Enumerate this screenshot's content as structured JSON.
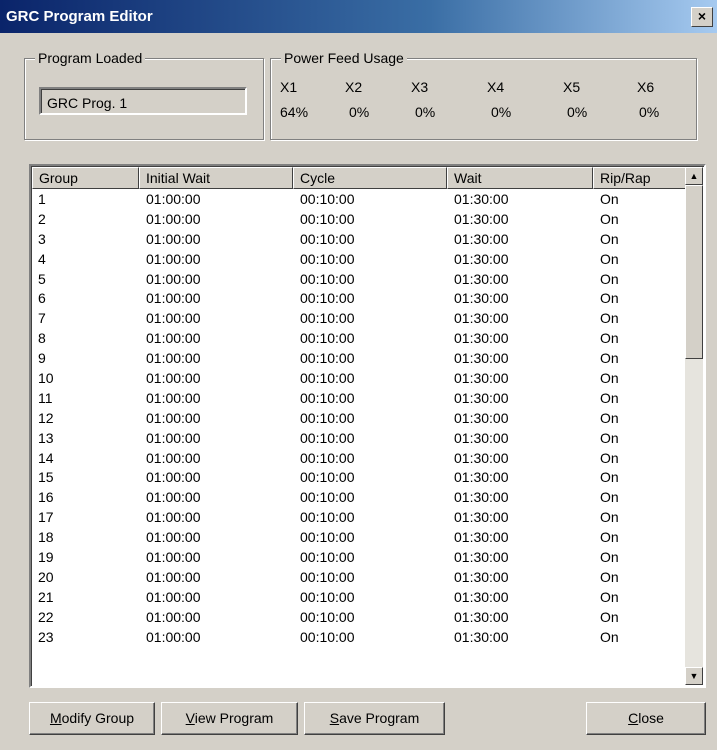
{
  "window": {
    "title": "GRC Program Editor",
    "close_glyph": "×"
  },
  "program_loaded": {
    "label": "Program Loaded",
    "value": "GRC Prog. 1"
  },
  "power_feed": {
    "label": "Power Feed Usage",
    "feeds": [
      {
        "name": "X1",
        "value": "64%"
      },
      {
        "name": "X2",
        "value": "0%"
      },
      {
        "name": "X3",
        "value": "0%"
      },
      {
        "name": "X4",
        "value": "0%"
      },
      {
        "name": "X5",
        "value": "0%"
      },
      {
        "name": "X6",
        "value": "0%"
      }
    ]
  },
  "table": {
    "columns": [
      "Group",
      "Initial Wait",
      "Cycle",
      "Wait",
      "Rip/Rap"
    ],
    "rows": [
      [
        "1",
        "01:00:00",
        "00:10:00",
        "01:30:00",
        "On"
      ],
      [
        "2",
        "01:00:00",
        "00:10:00",
        "01:30:00",
        "On"
      ],
      [
        "3",
        "01:00:00",
        "00:10:00",
        "01:30:00",
        "On"
      ],
      [
        "4",
        "01:00:00",
        "00:10:00",
        "01:30:00",
        "On"
      ],
      [
        "5",
        "01:00:00",
        "00:10:00",
        "01:30:00",
        "On"
      ],
      [
        "6",
        "01:00:00",
        "00:10:00",
        "01:30:00",
        "On"
      ],
      [
        "7",
        "01:00:00",
        "00:10:00",
        "01:30:00",
        "On"
      ],
      [
        "8",
        "01:00:00",
        "00:10:00",
        "01:30:00",
        "On"
      ],
      [
        "9",
        "01:00:00",
        "00:10:00",
        "01:30:00",
        "On"
      ],
      [
        "10",
        "01:00:00",
        "00:10:00",
        "01:30:00",
        "On"
      ],
      [
        "11",
        "01:00:00",
        "00:10:00",
        "01:30:00",
        "On"
      ],
      [
        "12",
        "01:00:00",
        "00:10:00",
        "01:30:00",
        "On"
      ],
      [
        "13",
        "01:00:00",
        "00:10:00",
        "01:30:00",
        "On"
      ],
      [
        "14",
        "01:00:00",
        "00:10:00",
        "01:30:00",
        "On"
      ],
      [
        "15",
        "01:00:00",
        "00:10:00",
        "01:30:00",
        "On"
      ],
      [
        "16",
        "01:00:00",
        "00:10:00",
        "01:30:00",
        "On"
      ],
      [
        "17",
        "01:00:00",
        "00:10:00",
        "01:30:00",
        "On"
      ],
      [
        "18",
        "01:00:00",
        "00:10:00",
        "01:30:00",
        "On"
      ],
      [
        "19",
        "01:00:00",
        "00:10:00",
        "01:30:00",
        "On"
      ],
      [
        "20",
        "01:00:00",
        "00:10:00",
        "01:30:00",
        "On"
      ],
      [
        "21",
        "01:00:00",
        "00:10:00",
        "01:30:00",
        "On"
      ],
      [
        "22",
        "01:00:00",
        "00:10:00",
        "01:30:00",
        "On"
      ],
      [
        "23",
        "01:00:00",
        "00:10:00",
        "01:30:00",
        "On"
      ]
    ]
  },
  "scrollbar": {
    "up_glyph": "▲",
    "down_glyph": "▼"
  },
  "buttons": {
    "modify": {
      "mnemonic": "M",
      "rest": "odify Group"
    },
    "view": {
      "mnemonic": "V",
      "rest": "iew Program"
    },
    "save": {
      "mnemonic": "S",
      "rest": "ave Program"
    },
    "close": {
      "mnemonic": "C",
      "rest": "lose"
    }
  }
}
